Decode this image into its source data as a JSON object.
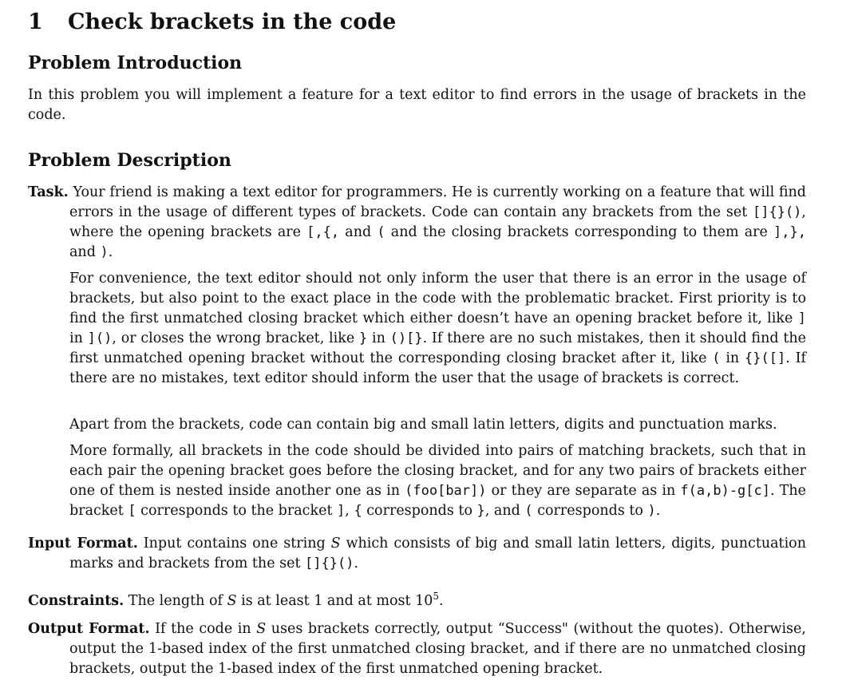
{
  "section": {
    "number": "1",
    "title": "Check brackets in the code"
  },
  "intro": {
    "heading": "Problem Introduction",
    "text": "In this problem you will implement a feature for a text editor to find errors in the usage of brackets in the code."
  },
  "description": {
    "heading": "Problem Description",
    "task_label": "Task.",
    "task_text_1": "Your friend is making a text editor for programmers. He is currently working on a feature that will find errors in the usage of different types of brackets. Code can contain any brackets from the set ",
    "bracket_set": "[]{}()",
    "task_text_2": ", where the opening brackets are ",
    "opening_list": "[,{,",
    "task_text_3": " and ",
    "opening_last": "(",
    "task_text_4": " and the closing brackets corresponding to them are ",
    "closing_list": "],},",
    "task_text_5": " and ",
    "closing_last": ")",
    "task_text_6": ".",
    "p2_1": "For convenience, the text editor should not only inform the user that there is an error in the usage of brackets, but also point to the exact place in the code with the problematic bracket. First priority is to find the first unmatched closing bracket which either doesn’t have an opening bracket before it, like ",
    "p2_c1": "]",
    "p2_2": " in ",
    "p2_c2": "]()",
    "p2_3": ", or closes the wrong bracket, like ",
    "p2_c3": "}",
    "p2_4": " in ",
    "p2_c4": "()[}",
    "p2_5": ". If there are no such mistakes, then it should find the first unmatched opening bracket without the corresponding closing bracket after it, like ",
    "p2_c5": "(",
    "p2_6": " in ",
    "p2_c6": "{}([]",
    "p2_7": ". If there are no mistakes, text editor should inform the user that the usage of brackets is correct.",
    "p3": "Apart from the brackets, code can contain big and small latin letters, digits and punctuation marks.",
    "p4_1": "More formally, all brackets in the code should be divided into pairs of matching brackets, such that in each pair the opening bracket goes before the closing bracket, and for any two pairs of brackets either one of them is nested inside another one as in ",
    "p4_c1": "(foo[bar])",
    "p4_2": " or they are separate as in ",
    "p4_c2": "f(a,b)-g[c]",
    "p4_3": ". The bracket ",
    "p4_c3": "[",
    "p4_4": " corresponds to the bracket ",
    "p4_c4": "]",
    "p4_5": ", ",
    "p4_c5": "{",
    "p4_6": " corresponds to ",
    "p4_c6": "}",
    "p4_7": ", and ",
    "p4_c7": "(",
    "p4_8": " corresponds to ",
    "p4_c8": ")",
    "p4_9": "."
  },
  "input_format": {
    "label": "Input Format.",
    "text_1": "Input contains one string ",
    "var": "S",
    "text_2": " which consists of big and small latin letters, digits, punctuation marks and brackets from the set ",
    "set": "[]{}()",
    "text_3": "."
  },
  "constraints": {
    "label": "Constraints.",
    "text_1": "The length of ",
    "var": "S",
    "text_2": " is at least 1 and at most 10",
    "exp": "5",
    "text_3": "."
  },
  "output_format": {
    "label": "Output Format.",
    "text_1": "If the code in ",
    "var": "S",
    "text_2": " uses brackets correctly, output “Success\" (without the quotes). Otherwise, output the 1-based index of the first unmatched closing bracket, and if there are no unmatched closing brackets, output the 1-based index of the first unmatched opening bracket."
  }
}
